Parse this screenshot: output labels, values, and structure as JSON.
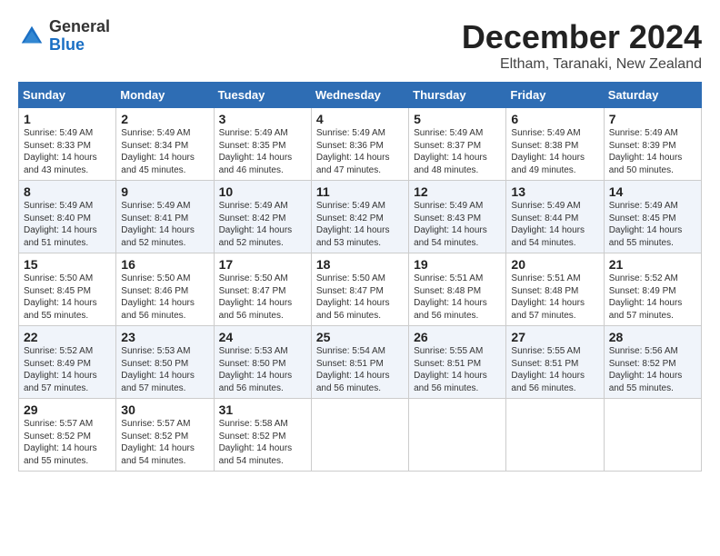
{
  "header": {
    "logo_general": "General",
    "logo_blue": "Blue",
    "month_title": "December 2024",
    "location": "Eltham, Taranaki, New Zealand"
  },
  "days_of_week": [
    "Sunday",
    "Monday",
    "Tuesday",
    "Wednesday",
    "Thursday",
    "Friday",
    "Saturday"
  ],
  "weeks": [
    [
      {
        "day": "1",
        "sunrise": "Sunrise: 5:49 AM",
        "sunset": "Sunset: 8:33 PM",
        "daylight": "Daylight: 14 hours and 43 minutes."
      },
      {
        "day": "2",
        "sunrise": "Sunrise: 5:49 AM",
        "sunset": "Sunset: 8:34 PM",
        "daylight": "Daylight: 14 hours and 45 minutes."
      },
      {
        "day": "3",
        "sunrise": "Sunrise: 5:49 AM",
        "sunset": "Sunset: 8:35 PM",
        "daylight": "Daylight: 14 hours and 46 minutes."
      },
      {
        "day": "4",
        "sunrise": "Sunrise: 5:49 AM",
        "sunset": "Sunset: 8:36 PM",
        "daylight": "Daylight: 14 hours and 47 minutes."
      },
      {
        "day": "5",
        "sunrise": "Sunrise: 5:49 AM",
        "sunset": "Sunset: 8:37 PM",
        "daylight": "Daylight: 14 hours and 48 minutes."
      },
      {
        "day": "6",
        "sunrise": "Sunrise: 5:49 AM",
        "sunset": "Sunset: 8:38 PM",
        "daylight": "Daylight: 14 hours and 49 minutes."
      },
      {
        "day": "7",
        "sunrise": "Sunrise: 5:49 AM",
        "sunset": "Sunset: 8:39 PM",
        "daylight": "Daylight: 14 hours and 50 minutes."
      }
    ],
    [
      {
        "day": "8",
        "sunrise": "Sunrise: 5:49 AM",
        "sunset": "Sunset: 8:40 PM",
        "daylight": "Daylight: 14 hours and 51 minutes."
      },
      {
        "day": "9",
        "sunrise": "Sunrise: 5:49 AM",
        "sunset": "Sunset: 8:41 PM",
        "daylight": "Daylight: 14 hours and 52 minutes."
      },
      {
        "day": "10",
        "sunrise": "Sunrise: 5:49 AM",
        "sunset": "Sunset: 8:42 PM",
        "daylight": "Daylight: 14 hours and 52 minutes."
      },
      {
        "day": "11",
        "sunrise": "Sunrise: 5:49 AM",
        "sunset": "Sunset: 8:42 PM",
        "daylight": "Daylight: 14 hours and 53 minutes."
      },
      {
        "day": "12",
        "sunrise": "Sunrise: 5:49 AM",
        "sunset": "Sunset: 8:43 PM",
        "daylight": "Daylight: 14 hours and 54 minutes."
      },
      {
        "day": "13",
        "sunrise": "Sunrise: 5:49 AM",
        "sunset": "Sunset: 8:44 PM",
        "daylight": "Daylight: 14 hours and 54 minutes."
      },
      {
        "day": "14",
        "sunrise": "Sunrise: 5:49 AM",
        "sunset": "Sunset: 8:45 PM",
        "daylight": "Daylight: 14 hours and 55 minutes."
      }
    ],
    [
      {
        "day": "15",
        "sunrise": "Sunrise: 5:50 AM",
        "sunset": "Sunset: 8:45 PM",
        "daylight": "Daylight: 14 hours and 55 minutes."
      },
      {
        "day": "16",
        "sunrise": "Sunrise: 5:50 AM",
        "sunset": "Sunset: 8:46 PM",
        "daylight": "Daylight: 14 hours and 56 minutes."
      },
      {
        "day": "17",
        "sunrise": "Sunrise: 5:50 AM",
        "sunset": "Sunset: 8:47 PM",
        "daylight": "Daylight: 14 hours and 56 minutes."
      },
      {
        "day": "18",
        "sunrise": "Sunrise: 5:50 AM",
        "sunset": "Sunset: 8:47 PM",
        "daylight": "Daylight: 14 hours and 56 minutes."
      },
      {
        "day": "19",
        "sunrise": "Sunrise: 5:51 AM",
        "sunset": "Sunset: 8:48 PM",
        "daylight": "Daylight: 14 hours and 56 minutes."
      },
      {
        "day": "20",
        "sunrise": "Sunrise: 5:51 AM",
        "sunset": "Sunset: 8:48 PM",
        "daylight": "Daylight: 14 hours and 57 minutes."
      },
      {
        "day": "21",
        "sunrise": "Sunrise: 5:52 AM",
        "sunset": "Sunset: 8:49 PM",
        "daylight": "Daylight: 14 hours and 57 minutes."
      }
    ],
    [
      {
        "day": "22",
        "sunrise": "Sunrise: 5:52 AM",
        "sunset": "Sunset: 8:49 PM",
        "daylight": "Daylight: 14 hours and 57 minutes."
      },
      {
        "day": "23",
        "sunrise": "Sunrise: 5:53 AM",
        "sunset": "Sunset: 8:50 PM",
        "daylight": "Daylight: 14 hours and 57 minutes."
      },
      {
        "day": "24",
        "sunrise": "Sunrise: 5:53 AM",
        "sunset": "Sunset: 8:50 PM",
        "daylight": "Daylight: 14 hours and 56 minutes."
      },
      {
        "day": "25",
        "sunrise": "Sunrise: 5:54 AM",
        "sunset": "Sunset: 8:51 PM",
        "daylight": "Daylight: 14 hours and 56 minutes."
      },
      {
        "day": "26",
        "sunrise": "Sunrise: 5:55 AM",
        "sunset": "Sunset: 8:51 PM",
        "daylight": "Daylight: 14 hours and 56 minutes."
      },
      {
        "day": "27",
        "sunrise": "Sunrise: 5:55 AM",
        "sunset": "Sunset: 8:51 PM",
        "daylight": "Daylight: 14 hours and 56 minutes."
      },
      {
        "day": "28",
        "sunrise": "Sunrise: 5:56 AM",
        "sunset": "Sunset: 8:52 PM",
        "daylight": "Daylight: 14 hours and 55 minutes."
      }
    ],
    [
      {
        "day": "29",
        "sunrise": "Sunrise: 5:57 AM",
        "sunset": "Sunset: 8:52 PM",
        "daylight": "Daylight: 14 hours and 55 minutes."
      },
      {
        "day": "30",
        "sunrise": "Sunrise: 5:57 AM",
        "sunset": "Sunset: 8:52 PM",
        "daylight": "Daylight: 14 hours and 54 minutes."
      },
      {
        "day": "31",
        "sunrise": "Sunrise: 5:58 AM",
        "sunset": "Sunset: 8:52 PM",
        "daylight": "Daylight: 14 hours and 54 minutes."
      },
      null,
      null,
      null,
      null
    ]
  ]
}
